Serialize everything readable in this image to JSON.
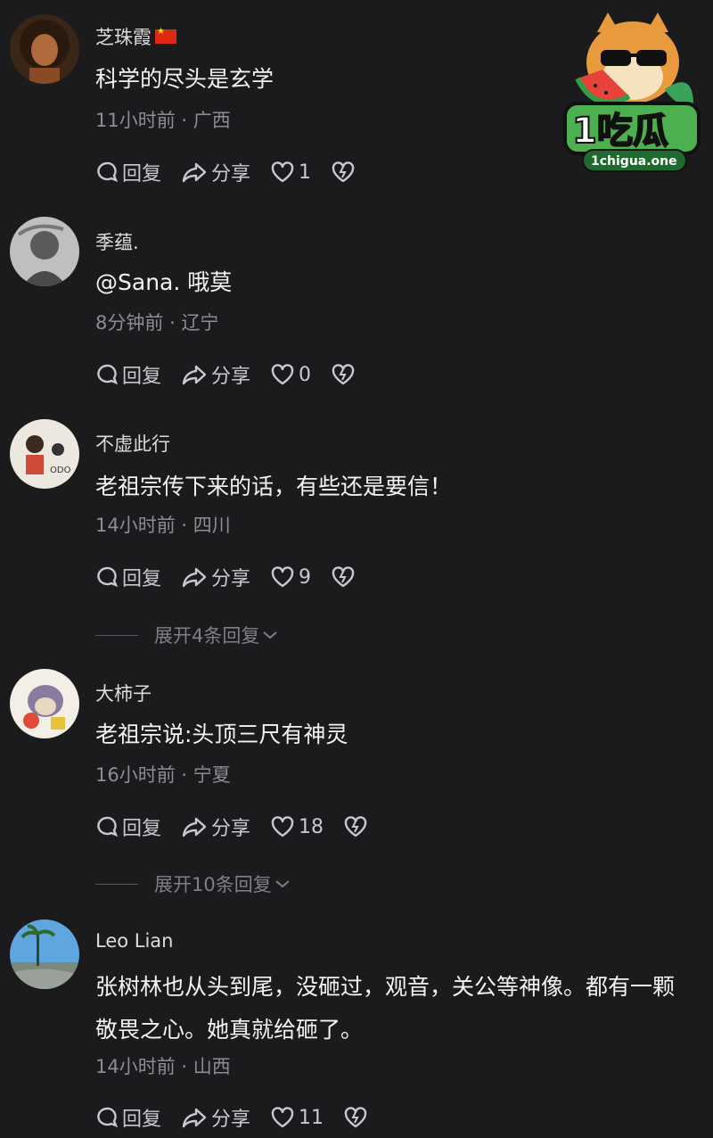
{
  "watermark": {
    "brand": "1吃瓜",
    "domain": "1chigua.one"
  },
  "comments": [
    {
      "user": "芝珠霞",
      "text": "科学的尽头是玄学",
      "time": "11小时前",
      "location": "广西",
      "reply_label": "回复",
      "share_label": "分享",
      "likes": "1"
    },
    {
      "user": "季蕴.",
      "text": "@Sana. 哦莫",
      "time": "8分钟前",
      "location": "辽宁",
      "reply_label": "回复",
      "share_label": "分享",
      "likes": "0"
    },
    {
      "user": "不虚此行",
      "text": "老祖宗传下来的话，有些还是要信！",
      "time": "14小时前",
      "location": "四川",
      "reply_label": "回复",
      "share_label": "分享",
      "likes": "9",
      "expand_label": "展开4条回复"
    },
    {
      "user": "大柿子",
      "text": "老祖宗说:头顶三尺有神灵",
      "time": "16小时前",
      "location": "宁夏",
      "reply_label": "回复",
      "share_label": "分享",
      "likes": "18",
      "expand_label": "展开10条回复"
    },
    {
      "user": "Leo Lian",
      "text": "张树林也从头到尾，没砸过，观音，关公等神像。都有一颗敬畏之心。她真就给砸了。",
      "time": "14小时前",
      "location": "山西",
      "reply_label": "回复",
      "share_label": "分享",
      "likes": "11"
    }
  ],
  "meta_separator": "·",
  "colors": {
    "background": "#1b1b1d",
    "text_primary": "#f2f2f4",
    "text_secondary": "#8d8d92",
    "flag_red": "#de2910"
  },
  "icons": [
    "reply-icon",
    "share-icon",
    "heart-icon",
    "dislike-heart-icon",
    "chevron-down-icon",
    "china-flag-icon"
  ]
}
